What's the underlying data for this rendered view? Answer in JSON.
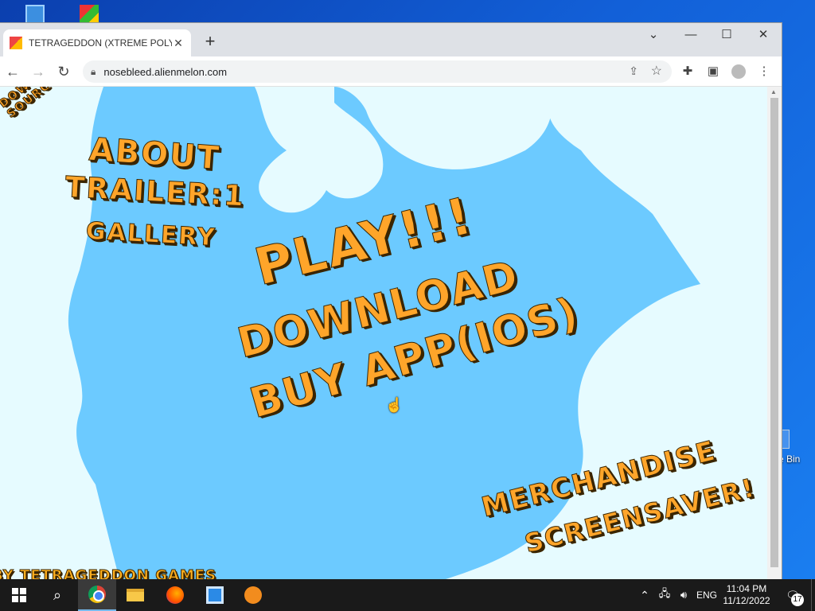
{
  "browser": {
    "tab_title": "TETRAGEDDON (XTREME POLYGONS)",
    "tab_close": "✕",
    "new_tab": "+",
    "url": "nosebleed.alienmelon.com",
    "window_controls": {
      "tab_search": "⌄",
      "minimize": "—",
      "maximize": "☐",
      "close": "✕"
    }
  },
  "page": {
    "download_source": "DOWNLOAD SOURCE",
    "about": "ABOUT",
    "trailer": "TRAILER:1",
    "gallery": "GALLERY",
    "play": "PLAY!!!",
    "download": "DOWNLOAD",
    "buy_app": "BUY APP(IOS)",
    "merchandise": "MERCHANDISE",
    "screensaver": "SCREENSAVER!",
    "by_line": "BY TETRAGEDDON GAMES"
  },
  "desktop": {
    "recycle_bin_label": "e Bin"
  },
  "taskbar": {
    "language": "ENG",
    "time": "11:04 PM",
    "date": "11/12/2022",
    "notification_count": "17"
  },
  "colors": {
    "sky": "#6ccaff",
    "cloud": "#e6fbff",
    "text_orange": "#ffa52a",
    "text_outline": "#3a2500"
  }
}
